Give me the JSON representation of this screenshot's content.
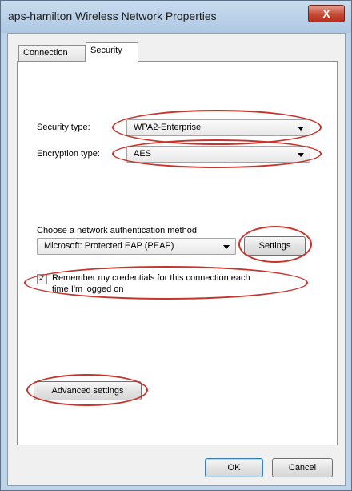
{
  "window": {
    "title": "aps-hamilton Wireless Network Properties",
    "close_label": "X"
  },
  "tabs": [
    {
      "label": "Connection"
    },
    {
      "label": "Security"
    }
  ],
  "security": {
    "security_type_label": "Security type:",
    "security_type_value": "WPA2-Enterprise",
    "encryption_type_label": "Encryption type:",
    "encryption_type_value": "AES",
    "auth_method_label": "Choose a network authentication method:",
    "auth_method_value": "Microsoft: Protected EAP (PEAP)",
    "settings_label": "Settings",
    "remember_label_line1": "Remember my credentials for this connection each",
    "remember_label_line2": "time I'm logged on",
    "remember_checked": true,
    "remember_check_glyph": "✓",
    "advanced_label": "Advanced settings"
  },
  "footer": {
    "ok_label": "OK",
    "cancel_label": "Cancel"
  },
  "colors": {
    "annotation_ellipse": "#c8332b"
  }
}
